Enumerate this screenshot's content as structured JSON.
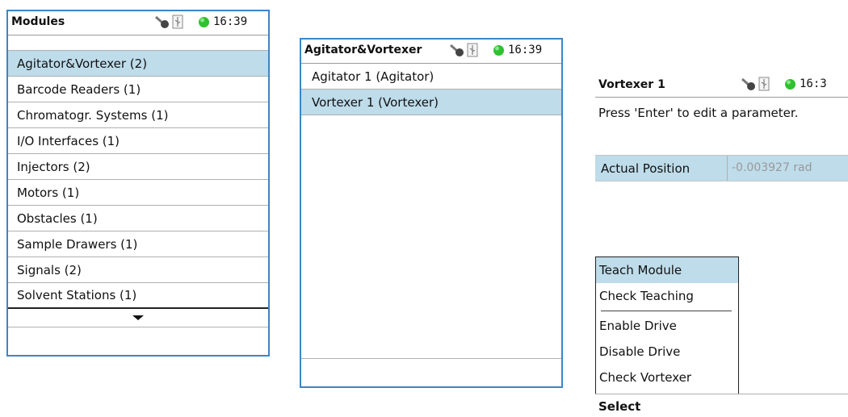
{
  "status": {
    "time": "16:39",
    "led_color": "#2ec22e"
  },
  "modules_panel": {
    "title": "Modules",
    "items": [
      "Agitator&Vortexer (2)",
      "Barcode Readers (1)",
      "Chromatogr. Systems (1)",
      "I/O Interfaces (1)",
      "Injectors (2)",
      "Motors (1)",
      "Obstacles (1)",
      "Sample Drawers (1)",
      "Signals (2)",
      "Solvent Stations (1)"
    ],
    "selected_index": 0
  },
  "agitator_panel": {
    "title": "Agitator&Vortexer",
    "items": [
      "Agitator 1 (Agitator)",
      "Vortexer 1 (Vortexer)"
    ],
    "selected_index": 1
  },
  "vortexer_panel": {
    "title": "Vortexer 1",
    "time_partial": "16:3",
    "hint": "Press 'Enter' to edit a parameter.",
    "param_label": "Actual Position",
    "param_value": "-0.003927 rad",
    "menu_items": [
      "Teach Module",
      "Check Teaching",
      "Enable Drive",
      "Disable Drive",
      "Check Vortexer"
    ],
    "menu_selected_index": 0,
    "footer": "Select"
  }
}
